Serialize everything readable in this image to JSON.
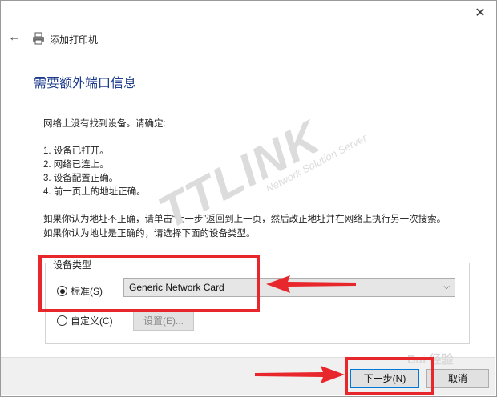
{
  "window": {
    "close_glyph": "✕",
    "back_glyph": "←",
    "title": "添加打印机"
  },
  "page": {
    "heading": "需要额外端口信息",
    "intro": "网络上没有找到设备。请确定:",
    "checklist": [
      "1.   设备已打开。",
      "2.   网络已连上。",
      "3.   设备配置正确。",
      "4.   前一页上的地址正确。"
    ],
    "advice": [
      "如果你认为地址不正确，请单击“上一步”返回到上一页，然后改正地址并在网络上执行另一次搜索。",
      "如果你认为地址是正确的，请选择下面的设备类型。"
    ]
  },
  "device_type": {
    "group_label": "设备类型",
    "standard_label": "标准(S)",
    "standard_selected": true,
    "standard_value": "Generic Network Card",
    "custom_label": "自定义(C)",
    "custom_selected": false,
    "settings_button": "设置(E)..."
  },
  "footer": {
    "next_button": "下一步(N)",
    "cancel_button": "取消"
  },
  "watermark": {
    "brand": "TTLINK",
    "tagline": "Network Solution Server"
  },
  "baidu_watermark": "Bai 经验",
  "colors": {
    "heading": "#1e3c8c",
    "annotation_red": "#e8272d",
    "focus_blue": "#0078d7"
  },
  "icons": {
    "close": "close-icon",
    "back": "back-arrow-icon",
    "printer": "printer-icon",
    "dropdown": "chevron-down-icon"
  }
}
